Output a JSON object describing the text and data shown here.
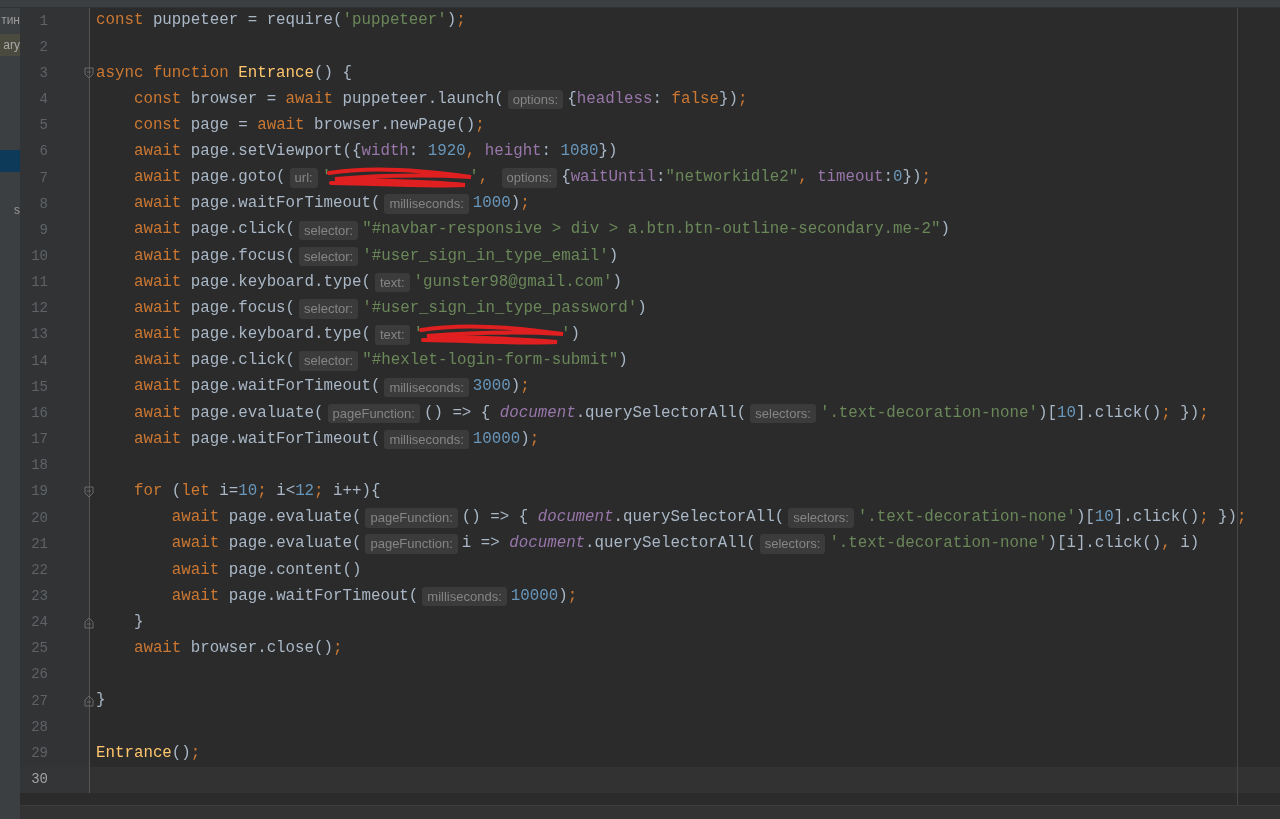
{
  "sidebar": {
    "items": [
      {
        "text": "тин",
        "selected": false,
        "match": false
      },
      {
        "text": "ary",
        "selected": false,
        "match": true
      },
      {
        "selected": true,
        "match": false
      },
      {
        "text": "s",
        "selected": false,
        "match": false
      }
    ]
  },
  "editor": {
    "lines": [
      {
        "number": "1",
        "current": false,
        "tokens": [
          {
            "kind": "kw",
            "text": "const"
          },
          {
            "kind": "plain",
            "text": " puppeteer = require("
          },
          {
            "kind": "str",
            "text": "'puppeteer'"
          },
          {
            "kind": "plain",
            "text": ")"
          },
          {
            "kind": "kw",
            "text": ";"
          }
        ]
      },
      {
        "number": "2",
        "current": false,
        "kind": "plain"
      },
      {
        "number": "3",
        "current": false,
        "kind": "fold-start",
        "tokens": [
          {
            "kind": "kw",
            "text": "async function "
          },
          {
            "kind": "fn",
            "text": "Entrance"
          },
          {
            "kind": "plain",
            "text": "() {"
          }
        ]
      },
      {
        "number": "4",
        "current": false,
        "tokens": [
          {
            "kind": "kw",
            "text": "    const"
          },
          {
            "kind": "plain",
            "text": " browser = "
          },
          {
            "kind": "kw",
            "text": "await"
          },
          {
            "kind": "plain",
            "text": " puppeteer.launch("
          },
          {
            "kind": "hint",
            "text": "options:"
          },
          {
            "kind": "plain",
            "text": "{"
          },
          {
            "kind": "prop",
            "text": "headless"
          },
          {
            "kind": "plain",
            "text": ": "
          },
          {
            "kind": "kw",
            "text": "false"
          },
          {
            "kind": "plain",
            "text": "})"
          },
          {
            "kind": "kw",
            "text": ";"
          }
        ]
      },
      {
        "number": "5",
        "current": false,
        "tokens": [
          {
            "kind": "kw",
            "text": "    const"
          },
          {
            "kind": "plain",
            "text": " page = "
          },
          {
            "kind": "kw",
            "text": "await"
          },
          {
            "kind": "plain",
            "text": " browser.newPage()"
          },
          {
            "kind": "kw",
            "text": ";"
          }
        ]
      },
      {
        "number": "6",
        "current": false,
        "tokens": [
          {
            "kind": "kw",
            "text": "    await"
          },
          {
            "kind": "plain",
            "text": " page.setViewport({"
          },
          {
            "kind": "prop",
            "text": "width"
          },
          {
            "kind": "plain",
            "text": ": "
          },
          {
            "kind": "num",
            "text": "1920"
          },
          {
            "kind": "kw",
            "text": ", "
          },
          {
            "kind": "prop",
            "text": "height"
          },
          {
            "kind": "plain",
            "text": ": "
          },
          {
            "kind": "num",
            "text": "1080"
          },
          {
            "kind": "plain",
            "text": "})"
          }
        ]
      },
      {
        "number": "7",
        "current": false,
        "tokens": [
          {
            "kind": "kw",
            "text": "    await"
          },
          {
            "kind": "plain",
            "text": " page.goto("
          },
          {
            "kind": "hint",
            "text": "url:"
          },
          {
            "kind": "str",
            "text": "'"
          },
          {
            "kind": "redaction"
          },
          {
            "kind": "str",
            "text": "'"
          },
          {
            "kind": "kw",
            "text": ", "
          },
          {
            "kind": "hint",
            "text": "options:"
          },
          {
            "kind": "plain",
            "text": "{"
          },
          {
            "kind": "prop",
            "text": "waitUntil"
          },
          {
            "kind": "plain",
            "text": ":"
          },
          {
            "kind": "str",
            "text": "\"networkidle2\""
          },
          {
            "kind": "kw",
            "text": ", "
          },
          {
            "kind": "prop",
            "text": "timeout"
          },
          {
            "kind": "plain",
            "text": ":"
          },
          {
            "kind": "num",
            "text": "0"
          },
          {
            "kind": "plain",
            "text": "})"
          },
          {
            "kind": "kw",
            "text": ";"
          }
        ]
      },
      {
        "number": "8",
        "current": false,
        "tokens": [
          {
            "kind": "kw",
            "text": "    await"
          },
          {
            "kind": "plain",
            "text": " page.waitForTimeout("
          },
          {
            "kind": "hint",
            "text": "milliseconds:"
          },
          {
            "kind": "num",
            "text": "1000"
          },
          {
            "kind": "plain",
            "text": ")"
          },
          {
            "kind": "kw",
            "text": ";"
          }
        ]
      },
      {
        "number": "9",
        "current": false,
        "tokens": [
          {
            "kind": "kw",
            "text": "    await"
          },
          {
            "kind": "plain",
            "text": " page.click("
          },
          {
            "kind": "hint",
            "text": "selector:"
          },
          {
            "kind": "str",
            "text": "\"#navbar-responsive > div > a.btn.btn-outline-secondary.me-2\""
          },
          {
            "kind": "plain",
            "text": ")"
          }
        ]
      },
      {
        "number": "10",
        "current": false,
        "tokens": [
          {
            "kind": "kw",
            "text": "    await"
          },
          {
            "kind": "plain",
            "text": " page.focus("
          },
          {
            "kind": "hint",
            "text": "selector:"
          },
          {
            "kind": "str",
            "text": "'#user_sign_in_type_email'"
          },
          {
            "kind": "plain",
            "text": ")"
          }
        ]
      },
      {
        "number": "11",
        "current": false,
        "tokens": [
          {
            "kind": "kw",
            "text": "    await"
          },
          {
            "kind": "plain",
            "text": " page.keyboard.type("
          },
          {
            "kind": "hint",
            "text": "text:"
          },
          {
            "kind": "str",
            "text": "'gunster98@gmail.com'"
          },
          {
            "kind": "plain",
            "text": ")"
          }
        ]
      },
      {
        "number": "12",
        "current": false,
        "tokens": [
          {
            "kind": "kw",
            "text": "    await"
          },
          {
            "kind": "plain",
            "text": " page.focus("
          },
          {
            "kind": "hint",
            "text": "selector:"
          },
          {
            "kind": "str",
            "text": "'#user_sign_in_type_password'"
          },
          {
            "kind": "plain",
            "text": ")"
          }
        ]
      },
      {
        "number": "13",
        "current": false,
        "tokens": [
          {
            "kind": "kw",
            "text": "    await"
          },
          {
            "kind": "plain",
            "text": " page.keyboard.type("
          },
          {
            "kind": "hint",
            "text": "text:"
          },
          {
            "kind": "str",
            "text": "'"
          },
          {
            "kind": "redaction"
          },
          {
            "kind": "str",
            "text": "'"
          },
          {
            "kind": "plain",
            "text": ")"
          }
        ]
      },
      {
        "number": "14",
        "current": false,
        "tokens": [
          {
            "kind": "kw",
            "text": "    await"
          },
          {
            "kind": "plain",
            "text": " page.click("
          },
          {
            "kind": "hint",
            "text": "selector:"
          },
          {
            "kind": "str",
            "text": "\"#hexlet-login-form-submit\""
          },
          {
            "kind": "plain",
            "text": ")"
          }
        ]
      },
      {
        "number": "15",
        "current": false,
        "tokens": [
          {
            "kind": "kw",
            "text": "    await"
          },
          {
            "kind": "plain",
            "text": " page.waitForTimeout("
          },
          {
            "kind": "hint",
            "text": "milliseconds:"
          },
          {
            "kind": "num",
            "text": "3000"
          },
          {
            "kind": "plain",
            "text": ")"
          },
          {
            "kind": "kw",
            "text": ";"
          }
        ]
      },
      {
        "number": "16",
        "current": false,
        "tokens": [
          {
            "kind": "kw",
            "text": "    await"
          },
          {
            "kind": "plain",
            "text": " page.evaluate("
          },
          {
            "kind": "hint",
            "text": "pageFunction:"
          },
          {
            "kind": "plain",
            "text": "() => { "
          },
          {
            "kind": "global",
            "text": "document"
          },
          {
            "kind": "plain",
            "text": ".querySelectorAll("
          },
          {
            "kind": "hint",
            "text": "selectors:"
          },
          {
            "kind": "str",
            "text": "'.text-decoration-none'"
          },
          {
            "kind": "plain",
            "text": ")["
          },
          {
            "kind": "num",
            "text": "10"
          },
          {
            "kind": "plain",
            "text": "].click()"
          },
          {
            "kind": "kw",
            "text": ";"
          },
          {
            "kind": "plain",
            "text": " })"
          },
          {
            "kind": "kw",
            "text": ";"
          }
        ]
      },
      {
        "number": "17",
        "current": false,
        "tokens": [
          {
            "kind": "kw",
            "text": "    await"
          },
          {
            "kind": "plain",
            "text": " page.waitForTimeout("
          },
          {
            "kind": "hint",
            "text": "milliseconds:"
          },
          {
            "kind": "num",
            "text": "10000"
          },
          {
            "kind": "plain",
            "text": ")"
          },
          {
            "kind": "kw",
            "text": ";"
          }
        ]
      },
      {
        "number": "18",
        "current": false,
        "kind": "plain"
      },
      {
        "number": "19",
        "current": false,
        "kind": "fold-start",
        "tokens": [
          {
            "kind": "kw",
            "text": "    for"
          },
          {
            "kind": "plain",
            "text": " ("
          },
          {
            "kind": "kw",
            "text": "let"
          },
          {
            "kind": "plain",
            "text": " i="
          },
          {
            "kind": "num",
            "text": "10"
          },
          {
            "kind": "kw",
            "text": ";"
          },
          {
            "kind": "plain",
            "text": " i<"
          },
          {
            "kind": "num",
            "text": "12"
          },
          {
            "kind": "kw",
            "text": ";"
          },
          {
            "kind": "plain",
            "text": " i++){"
          }
        ]
      },
      {
        "number": "20",
        "current": false,
        "tokens": [
          {
            "kind": "kw",
            "text": "        await"
          },
          {
            "kind": "plain",
            "text": " page.evaluate("
          },
          {
            "kind": "hint",
            "text": "pageFunction:"
          },
          {
            "kind": "plain",
            "text": "() => { "
          },
          {
            "kind": "global",
            "text": "document"
          },
          {
            "kind": "plain",
            "text": ".querySelectorAll("
          },
          {
            "kind": "hint",
            "text": "selectors:"
          },
          {
            "kind": "str",
            "text": "'.text-decoration-none'"
          },
          {
            "kind": "plain",
            "text": ")["
          },
          {
            "kind": "num",
            "text": "10"
          },
          {
            "kind": "plain",
            "text": "].click()"
          },
          {
            "kind": "kw",
            "text": ";"
          },
          {
            "kind": "plain",
            "text": " })"
          },
          {
            "kind": "kw",
            "text": ";"
          }
        ]
      },
      {
        "number": "21",
        "current": false,
        "tokens": [
          {
            "kind": "kw",
            "text": "        await"
          },
          {
            "kind": "plain",
            "text": " page.evaluate("
          },
          {
            "kind": "hint",
            "text": "pageFunction:"
          },
          {
            "kind": "plain",
            "text": "i => "
          },
          {
            "kind": "global",
            "text": "document"
          },
          {
            "kind": "plain",
            "text": ".querySelectorAll("
          },
          {
            "kind": "hint",
            "text": "selectors:"
          },
          {
            "kind": "str",
            "text": "'.text-decoration-none'"
          },
          {
            "kind": "plain",
            "text": ")[i].click()"
          },
          {
            "kind": "kw",
            "text": ", "
          },
          {
            "kind": "plain",
            "text": "i)"
          }
        ]
      },
      {
        "number": "22",
        "current": false,
        "tokens": [
          {
            "kind": "kw",
            "text": "        await"
          },
          {
            "kind": "plain",
            "text": " page.content()"
          }
        ]
      },
      {
        "number": "23",
        "current": false,
        "tokens": [
          {
            "kind": "kw",
            "text": "        await"
          },
          {
            "kind": "plain",
            "text": " page.waitForTimeout("
          },
          {
            "kind": "hint",
            "text": "milliseconds:"
          },
          {
            "kind": "num",
            "text": "10000"
          },
          {
            "kind": "plain",
            "text": ")"
          },
          {
            "kind": "kw",
            "text": ";"
          }
        ]
      },
      {
        "number": "24",
        "current": false,
        "kind": "fold-end",
        "tokens": [
          {
            "kind": "plain",
            "text": "    }"
          }
        ]
      },
      {
        "number": "25",
        "current": false,
        "tokens": [
          {
            "kind": "kw",
            "text": "    await"
          },
          {
            "kind": "plain",
            "text": " browser.close()"
          },
          {
            "kind": "kw",
            "text": ";"
          }
        ]
      },
      {
        "number": "26",
        "current": false,
        "kind": "plain"
      },
      {
        "number": "27",
        "current": false,
        "kind": "fold-end",
        "tokens": [
          {
            "kind": "plain",
            "text": "}"
          }
        ]
      },
      {
        "number": "28",
        "current": false,
        "kind": "plain"
      },
      {
        "number": "29",
        "current": false,
        "tokens": [
          {
            "kind": "fn",
            "text": "Entrance"
          },
          {
            "kind": "plain",
            "text": "()"
          },
          {
            "kind": "kw",
            "text": ";"
          }
        ]
      },
      {
        "number": "30",
        "current": true,
        "kind": "plain"
      }
    ]
  }
}
